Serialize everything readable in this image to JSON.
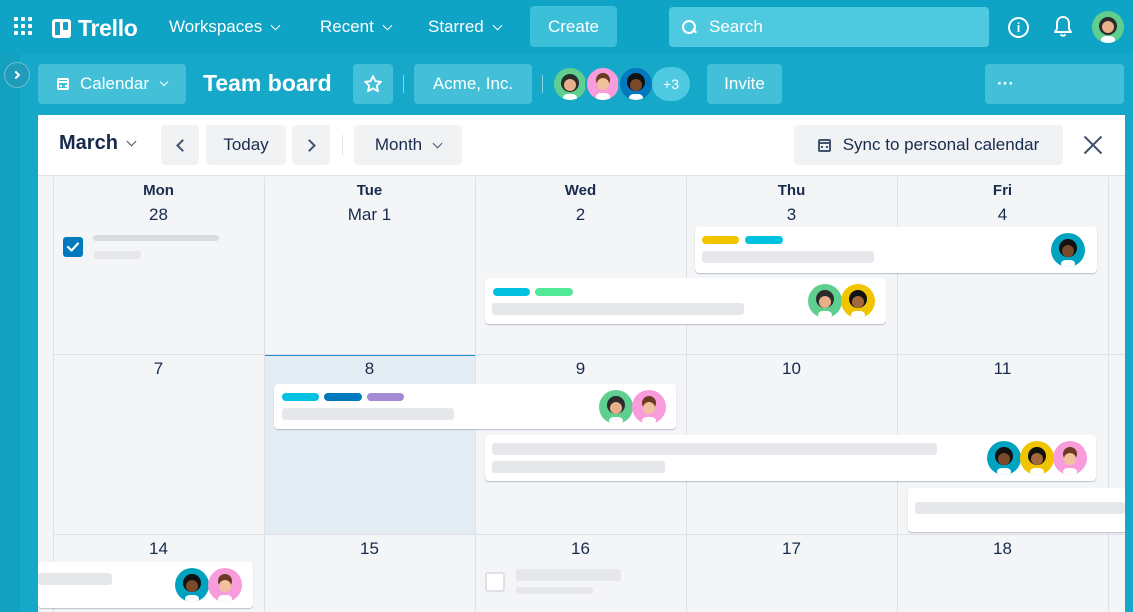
{
  "nav": {
    "logo_text": "Trello",
    "workspaces": "Workspaces",
    "recent": "Recent",
    "starred": "Starred",
    "create": "Create",
    "search_placeholder": "Search"
  },
  "board": {
    "view_label": "Calendar",
    "title": "Team board",
    "workspace": "Acme, Inc.",
    "extra_members": "+3",
    "invite": "Invite",
    "more": "···"
  },
  "calendar": {
    "month": "March",
    "today": "Today",
    "view": "Month",
    "sync": "Sync to personal calendar",
    "day_names": [
      "Mon",
      "Tue",
      "Wed",
      "Thu",
      "Fri"
    ],
    "weeks": [
      [
        "28",
        "Mar 1",
        "2",
        "3",
        "4"
      ],
      [
        "7",
        "8",
        "9",
        "10",
        "11"
      ],
      [
        "14",
        "15",
        "16",
        "17",
        "18"
      ]
    ]
  },
  "colors": {
    "brand": "#0fa3c6",
    "label_cyan": "#00c2e0",
    "label_green": "#51e898",
    "label_yellow": "#f2c400",
    "label_blue": "#0079bf",
    "label_purple": "#a48ad4",
    "today_bg": "#e4edf4"
  },
  "icons": {
    "apps": "grid-dots-icon",
    "info": "info-icon",
    "notifications": "bell-icon",
    "star": "star-icon",
    "calendar": "calendar-icon",
    "close": "close-icon"
  }
}
